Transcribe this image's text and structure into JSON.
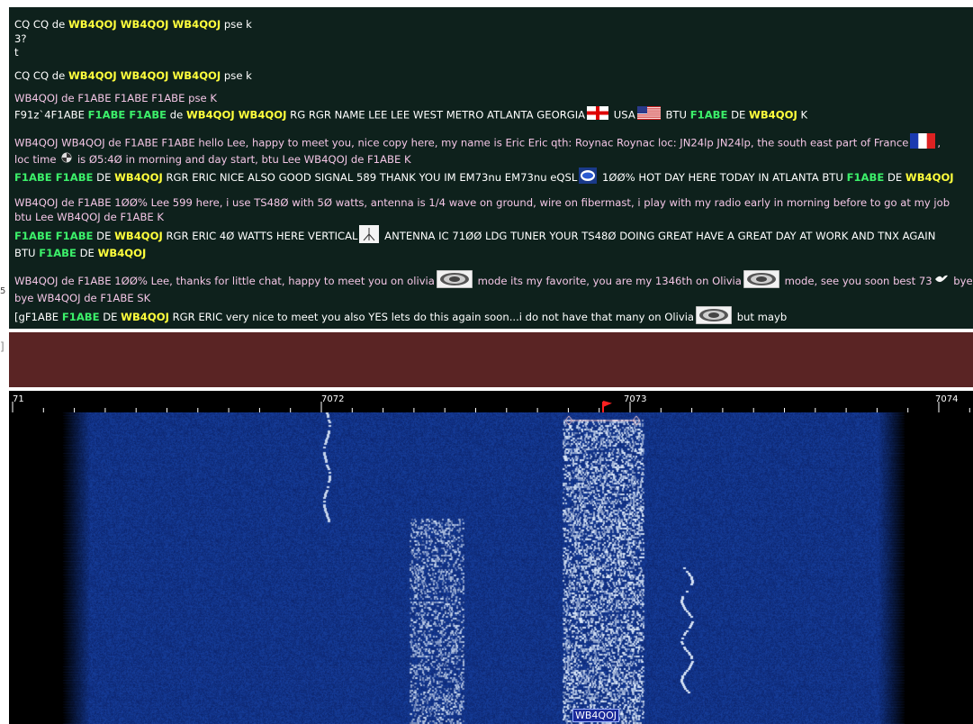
{
  "rx_lines": [
    [
      {
        "t": "CQ CQ de ",
        "c": "w"
      },
      {
        "t": "WB4QOJ WB4QOJ WB4QOJ",
        "c": "y"
      },
      {
        "t": " pse k",
        "c": "w"
      }
    ],
    [
      {
        "t": " 3?",
        "c": "w"
      }
    ],
    [
      {
        "t": "t",
        "c": "w"
      }
    ],
    [],
    [
      {
        "t": "CQ CQ de ",
        "c": "w"
      },
      {
        "t": "WB4QOJ WB4QOJ WB4QOJ",
        "c": "y"
      },
      {
        "t": " pse k",
        "c": "w"
      }
    ],
    [],
    [
      {
        "t": "   WB4QOJ de F1ABE F1ABE F1ABE pse K",
        "c": "pink"
      }
    ],
    [
      {
        "t": "F91z`4F1ABE ",
        "c": "w"
      },
      {
        "t": "F1ABE F1ABE",
        "c": "g"
      },
      {
        "t": " de ",
        "c": "w"
      },
      {
        "t": "WB4QOJ WB4QOJ",
        "c": "y"
      },
      {
        "t": " RG RGR NAME LEE LEE WEST METRO ATLANTA GEORGIA",
        "c": "w"
      },
      {
        "icon": "georgia-flag-icon"
      },
      {
        "t": " USA",
        "c": "w"
      },
      {
        "icon": "usa-flag-icon"
      },
      {
        "t": " BTU ",
        "c": "w"
      },
      {
        "t": "F1ABE",
        "c": "g"
      },
      {
        "t": " DE ",
        "c": "w"
      },
      {
        "t": "WB4QOJ",
        "c": "y"
      },
      {
        "t": " K",
        "c": "w"
      }
    ],
    [],
    [
      {
        "t": "  WB4QOJ WB4QOJ de F1ABE F1ABE  hello Lee, happy to meet you, nice copy here, my name is Eric Eric   qth: Roynac Roynac  loc: JN24lp JN24lp, the south east part of France",
        "c": "pink"
      },
      {
        "icon": "france-flag-icon"
      },
      {
        "t": ",",
        "c": "pink"
      }
    ],
    [
      {
        "t": "loc time ",
        "c": "pink"
      },
      {
        "icon": "clock-icon"
      },
      {
        "t": "  is Ø5:4Ø in morning and day start, btu Lee  WB4QOJ de F1ABE K",
        "c": "pink"
      }
    ],
    [
      {
        "t": "F1ABE F1ABE",
        "c": "g"
      },
      {
        "t": " DE ",
        "c": "w"
      },
      {
        "t": "WB4QOJ",
        "c": "y"
      },
      {
        "t": " RGR ERIC NICE ALSO GOOD SIGNAL 589 THANK YOU IM EM73nu EM73nu eQSL",
        "c": "w"
      },
      {
        "icon": "eqsl-logo-icon"
      },
      {
        "t": " 1ØØ%  HOT DAY HERE TODAY IN ATLANTA BTU ",
        "c": "w"
      },
      {
        "t": "F1ABE",
        "c": "g"
      },
      {
        "t": " DE ",
        "c": "w"
      },
      {
        "t": "WB4QOJ",
        "c": "y"
      }
    ],
    [],
    [
      {
        "t": " WB4QOJ de F1ABE  1ØØ% Lee   599 here, i use TS48Ø with 5Ø watts, antenna is 1/4 wave on ground, wire on fibermast, i play with my radio early in morning before to go at my job",
        "c": "pink"
      }
    ],
    [
      {
        "t": "btu Lee WB4QOJ de F1ABE K",
        "c": "pink"
      }
    ],
    [
      {
        "t": "F1ABE F1ABE",
        "c": "g"
      },
      {
        "t": " DE ",
        "c": "w"
      },
      {
        "t": "WB4QOJ",
        "c": "y"
      },
      {
        "t": " RGR ERIC 4Ø WATTS HERE VERTICAL",
        "c": "w"
      },
      {
        "icon": "antenna-icon"
      },
      {
        "t": "  ANTENNA IC 71ØØ LDG TUNER YOUR TS48Ø DOING GREAT HAVE A GREAT DAY AT WORK AND TNX AGAIN",
        "c": "w"
      }
    ],
    [
      {
        "t": "BTU ",
        "c": "w"
      },
      {
        "t": "F1ABE",
        "c": "g"
      },
      {
        "t": " DE ",
        "c": "w"
      },
      {
        "t": "WB4QOJ",
        "c": "y"
      }
    ],
    [],
    [
      {
        "t": " WB4QOJ de F1ABE 1ØØ% Lee, thanks for little chat, happy to meet you on olivia",
        "c": "pink"
      },
      {
        "icon": "olivia-logo-icon"
      },
      {
        "t": "  mode its my favorite, you are my 1346th on Olivia",
        "c": "pink"
      },
      {
        "icon": "olivia-logo-icon"
      },
      {
        "t": "  mode, see you soon best 73",
        "c": "pink"
      },
      {
        "icon": "dove-icon"
      },
      {
        "t": "  bye",
        "c": "pink"
      }
    ],
    [
      {
        "t": "bye  WB4QOJ de F1ABE  SK",
        "c": "pink"
      }
    ],
    [
      {
        "t": "[gF1ABE ",
        "c": "w"
      },
      {
        "t": "F1ABE",
        "c": "g"
      },
      {
        "t": " DE ",
        "c": "w"
      },
      {
        "t": "WB4QOJ",
        "c": "y"
      },
      {
        "t": " RGR ERIC very nice to meet you also YES lets do this again soon...i do not have that many on Olivia",
        "c": "w"
      },
      {
        "icon": "olivia-logo-icon"
      },
      {
        "t": "  but mayb",
        "c": "w"
      }
    ]
  ],
  "left_stub_1": "5",
  "left_stub_2": "]",
  "waterfall": {
    "scale_labels": [
      {
        "text": "71"
      },
      {
        "text": "7072"
      },
      {
        "text": "7073"
      },
      {
        "text": "7074"
      }
    ],
    "signal_tag": "WB4QOJ",
    "colors": {
      "bg": "#0a1a5c",
      "signal": "#e6f2ff"
    }
  }
}
